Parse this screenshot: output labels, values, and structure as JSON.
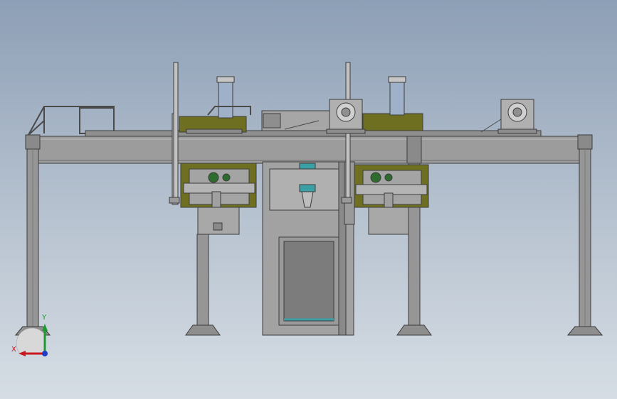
{
  "viewport": {
    "background_top": "#8d9fb6",
    "background_bottom": "#d6dde4",
    "part_colors": {
      "frame_gray": "#9a9a9a",
      "frame_edge": "#3c3c3c",
      "olive_plate": "#6f6f22",
      "cylinder": "#9eb1c8",
      "teal_part": "#3aa0a6",
      "green_part": "#2e6b2e"
    }
  },
  "triad": {
    "x_label": "X",
    "y_label": "Y",
    "x_color": "#c8191e",
    "y_color": "#1e9a32",
    "z_color": "#1e3cc8"
  }
}
